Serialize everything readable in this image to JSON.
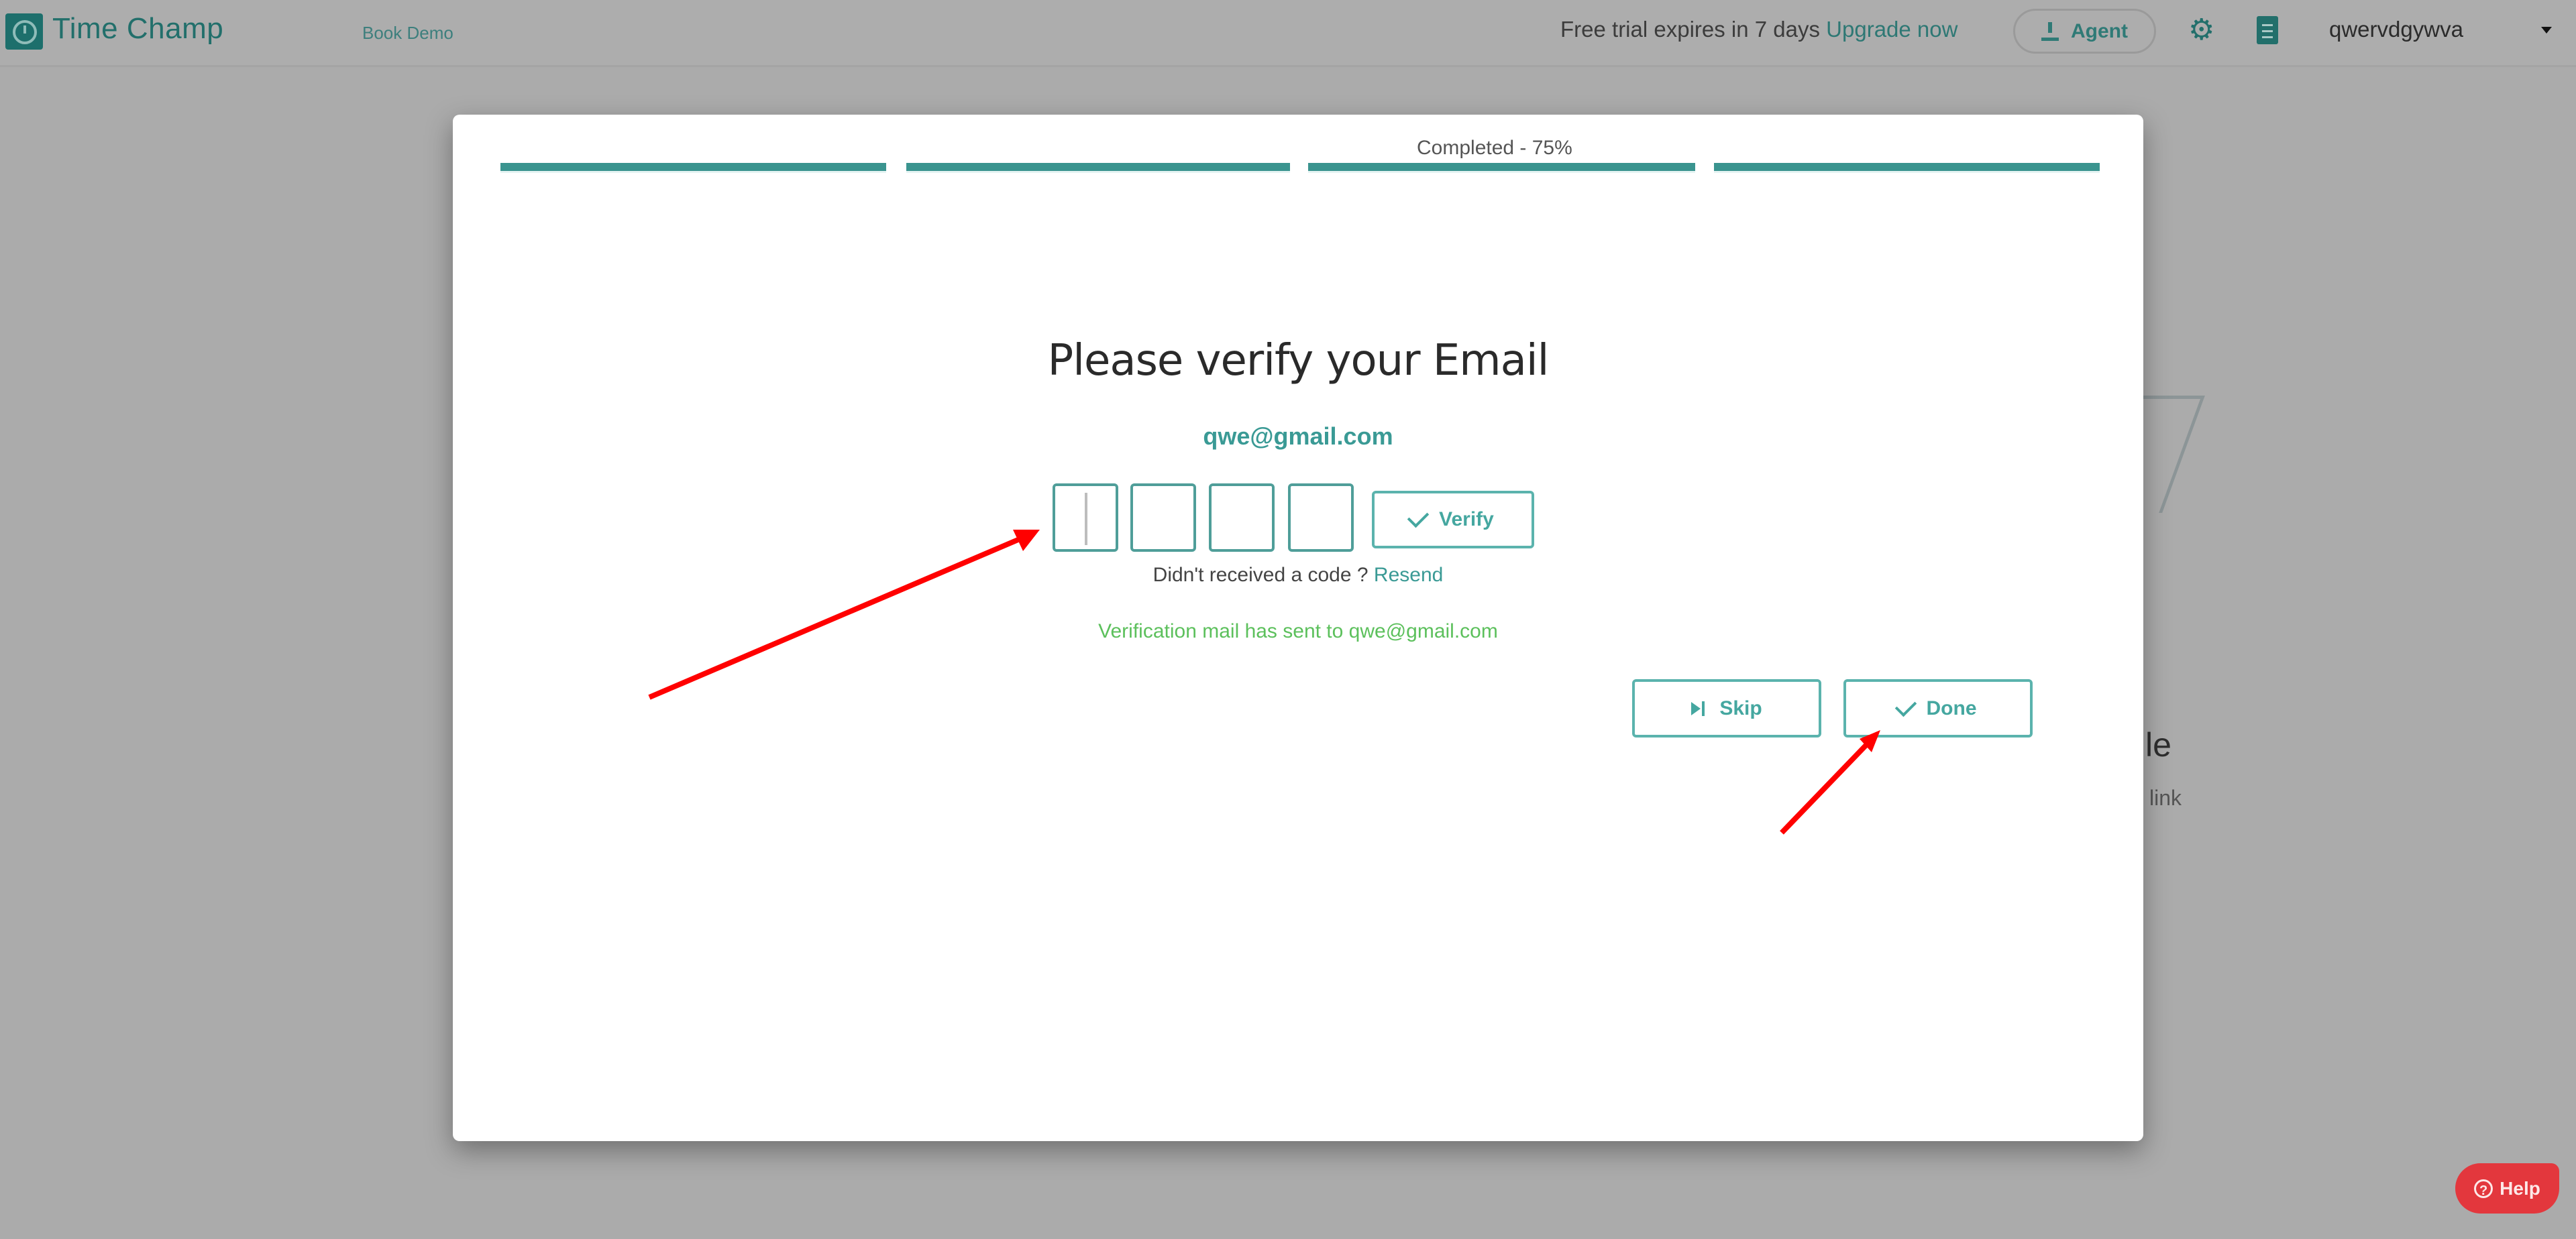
{
  "header": {
    "brand": "Time Champ",
    "book_demo": "Book Demo",
    "trial_text": "Free trial expires in 7 days",
    "upgrade_link": "Upgrade now",
    "agent_button": "Agent",
    "username": "qwervdgywva",
    "icons": {
      "logo": "clock-logo-icon",
      "agent": "download-icon",
      "settings": "gear-icon",
      "notes": "clipboard-icon",
      "menu": "caret-down-icon"
    }
  },
  "background": {
    "peek_heading_fragment": "le",
    "peek_text_fragment": "link"
  },
  "modal": {
    "progress": {
      "label": "Completed - 75%",
      "percent": 75,
      "segments": 4
    },
    "title": "Please verify your Email",
    "email": "qwe@gmail.com",
    "code_inputs": [
      {
        "value": "",
        "placeholder": ""
      },
      {
        "value": "",
        "placeholder": ""
      },
      {
        "value": "",
        "placeholder": ""
      },
      {
        "value": "",
        "placeholder": ""
      }
    ],
    "verify_button": "Verify",
    "resend_prompt": "Didn't received a code ?",
    "resend_link": "Resend",
    "sent_message": "Verification mail has sent to qwe@gmail.com",
    "skip_button": "Skip",
    "done_button": "Done"
  },
  "help_button": "Help",
  "colors": {
    "accent": "#3a948f",
    "link": "#3a9a95",
    "success": "#5cc05c",
    "help": "#e3373d",
    "annotation_arrow": "#ff0000"
  }
}
